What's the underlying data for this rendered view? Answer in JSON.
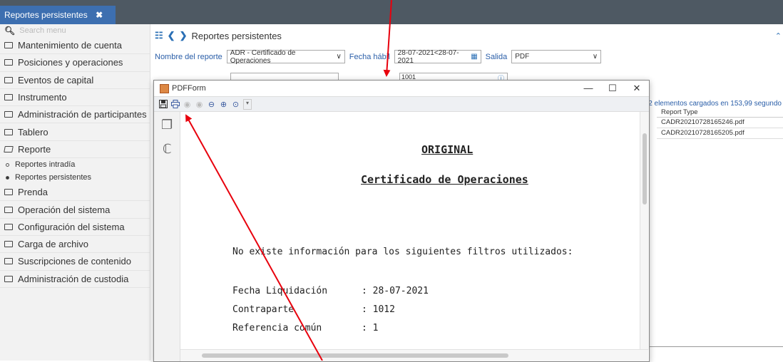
{
  "top_tab": {
    "label": "Reportes persistentes",
    "close": "✖",
    "add": "+"
  },
  "sidebar": {
    "search_placeholder": "Search menu",
    "items": [
      {
        "label": "Mantenimiento de cuenta"
      },
      {
        "label": "Posiciones y operaciones"
      },
      {
        "label": "Eventos de capital"
      },
      {
        "label": "Instrumento"
      },
      {
        "label": "Administración de participantes"
      },
      {
        "label": "Tablero"
      },
      {
        "label": "Reporte"
      }
    ],
    "subitems": [
      {
        "label": "Reportes intradía"
      },
      {
        "label": "Reportes persistentes"
      }
    ],
    "items_after": [
      {
        "label": "Prenda"
      },
      {
        "label": "Operación del sistema"
      },
      {
        "label": "Configuración del sistema"
      },
      {
        "label": "Carga de archivo"
      },
      {
        "label": "Suscripciones de contenido"
      },
      {
        "label": "Administración de custodia"
      }
    ]
  },
  "main": {
    "breadcrumb": "Reportes persistentes",
    "filters": {
      "report_name_label": "Nombre del reporte",
      "report_name_value": "ADR - Certificado de Operaciones",
      "date_label": "Fecha hábil",
      "date_value": "28-07-2021<28-07-2021",
      "output_label": "Salida",
      "output_value": "PDF",
      "partial_value": "1001"
    },
    "status_text": "2 elementos cargados en 153,99 segundo",
    "grid": {
      "header": "Report Type",
      "rows": [
        "CADR20210728165246.pdf",
        "CADR20210728165205.pdf"
      ]
    }
  },
  "dialog": {
    "title": "PDFForm",
    "min": "—",
    "max": "☐",
    "close": "✕",
    "document": {
      "title1": "ORIGINAL",
      "title2": "Certificado de Operaciones",
      "message": "No existe información para los siguientes filtros utilizados:",
      "fields": [
        {
          "label": "Fecha Liquidación",
          "value": ": 28-07-2021"
        },
        {
          "label": "Contraparte",
          "value": ": 1012"
        },
        {
          "label": "Referencia común",
          "value": ": 1"
        }
      ]
    }
  },
  "colors": {
    "accent": "#2a6fb5",
    "topbar": "#4e5963",
    "annotation": "#e8000d"
  }
}
